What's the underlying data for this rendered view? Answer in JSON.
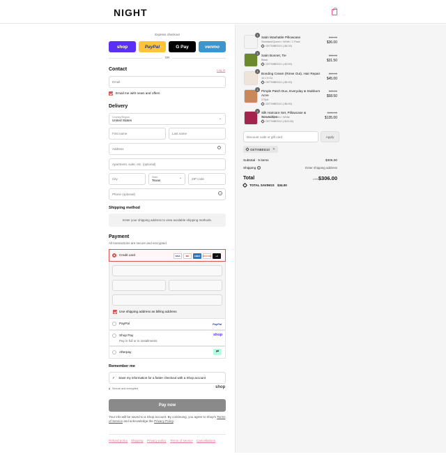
{
  "brand": {
    "logo": "NIGHT"
  },
  "express": {
    "label": "Express checkout",
    "or": "OR",
    "buttons": [
      {
        "label": "shop",
        "color": "#5a31f4"
      },
      {
        "label": "PayPal",
        "color": "#ffc439"
      },
      {
        "label": "G Pay",
        "color": "#000000"
      },
      {
        "label": "venmo",
        "color": "#3d95ce"
      }
    ]
  },
  "contact": {
    "title": "Contact",
    "login": "Log in",
    "email_placeholder": "Email",
    "news_label": "Email me with news and offers"
  },
  "delivery": {
    "title": "Delivery",
    "country_label": "Country/Region",
    "country_value": "United States",
    "first_name": "First name",
    "last_name": "Last name",
    "address": "Address",
    "apartment": "Apartment, suite, etc. (optional)",
    "city": "City",
    "state_label": "State",
    "state_value": "Texas",
    "zip": "ZIP code",
    "phone": "Phone (optional)"
  },
  "shipping_method": {
    "title": "Shipping method",
    "message": "Enter your shipping address to view available shipping methods."
  },
  "payment": {
    "title": "Payment",
    "subtitle": "All transactions are secure and encrypted.",
    "credit_card": "Credit card",
    "card_logos": [
      "VISA",
      "MC",
      "AMEX",
      "DISCOVER",
      "+4"
    ],
    "billing_same": "Use shipping address as billing address",
    "paypal": "PayPal",
    "paypal_logo": "PayPal",
    "shop_pay": "Shop Pay",
    "shop_pay_sub": "Pay in full or in installments",
    "shop_logo": "shop",
    "afterpay": "Afterpay"
  },
  "remember": {
    "title": "Remember me",
    "save_label": "Save my information for a faster checkout with a Shop account",
    "secure": "Secure and encrypted",
    "shop_logo": "shop"
  },
  "pay_button": "Pay now",
  "legal": {
    "text1": "Your info will be saved to a Shop account. By continuing, you agree to Shop's",
    "tos": "Terms of Service",
    "text2": "and acknowledge the",
    "privacy": "Privacy Policy",
    "dot": "."
  },
  "footer_links": [
    "Refund policy",
    "Shipping",
    "Privacy policy",
    "Terms of service",
    "Cancellations"
  ],
  "order": {
    "items": [
      {
        "qty": "1",
        "name": "Satin Washable Pillowcase",
        "variant": "Standard/Queen / White / 1 Pack",
        "discount": "GETINBED10 (-$4.00)",
        "compare": "$40.00",
        "price": "$36.00",
        "thumb_color": "#f3f3f3"
      },
      {
        "qty": "1",
        "name": "Satin Bonnet, Tie",
        "variant": "Black",
        "discount": "GETINBED10 (-$3.50)",
        "compare": "$35.00",
        "price": "$31.50",
        "thumb_color": "#6b8a2e"
      },
      {
        "qty": "1",
        "name": "Bonding Cream (Rinse Out), Hair Repair",
        "variant": "10.1 fl Oz",
        "discount": "GETINBED10 (-$5.00)",
        "compare": "$50.00",
        "price": "$45.00",
        "thumb_color": "#efe4da"
      },
      {
        "qty": "1",
        "name": "Pimple Patch Duo, Everyday & Stubborn Acne",
        "variant": "270pk",
        "discount": "GETINBED10 (-$6.50)",
        "compare": "$65.00",
        "price": "$58.50",
        "thumb_color": "#c9875a"
      },
      {
        "qty": "1",
        "name": "Silk Haircare Set, Pillowcase & Scrunchies",
        "variant": "Standard/Queen / White",
        "discount": "GETINBED10 (-$15.00)",
        "compare": "$150.00",
        "price": "$135.00",
        "thumb_color": "#a3244d"
      }
    ],
    "discount_placeholder": "Discount code or gift card",
    "apply": "Apply",
    "applied_code": "GETINBED10",
    "subtotal_label": "Subtotal · 5 items",
    "subtotal": "$306.00",
    "shipping_label": "Shipping",
    "shipping_value": "Enter shipping address",
    "total_label": "Total",
    "currency": "USD",
    "total": "$306.00",
    "savings_label": "TOTAL SAVINGS",
    "savings": "$34.00"
  }
}
